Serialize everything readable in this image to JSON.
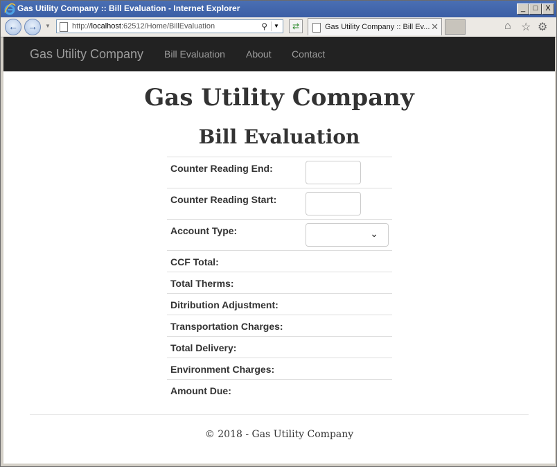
{
  "window": {
    "title": "Gas Utility Company :: Bill Evaluation - Internet Explorer",
    "url_prefix": "http://",
    "url_host": "localhost",
    "url_rest": ":62512/Home/BillEvaluation",
    "tab_title": "Gas Utility Company :: Bill Ev...",
    "buttons": {
      "minimize": "_",
      "maximize": "□",
      "close": "X"
    }
  },
  "navbar": {
    "brand": "Gas Utility Company",
    "links": [
      "Bill Evaluation",
      "About",
      "Contact"
    ]
  },
  "page": {
    "title": "Gas Utility Company",
    "subtitle": "Bill Evaluation"
  },
  "form": {
    "fields": [
      {
        "label": "Counter Reading End:",
        "value": ""
      },
      {
        "label": "Counter Reading Start:",
        "value": ""
      },
      {
        "label": "Account Type:",
        "value": ""
      }
    ],
    "outputs": [
      "CCF Total:",
      "Total Therms:",
      "Ditribution Adjustment:",
      "Transportation Charges:",
      "Total Delivery:",
      "Environment Charges:",
      "Amount Due:"
    ]
  },
  "footer": {
    "text": "© 2018 - Gas Utility Company"
  },
  "colors": {
    "navbar": "#222222",
    "nav_text": "#9d9d9d",
    "titlebar": "#3b5ea5"
  }
}
